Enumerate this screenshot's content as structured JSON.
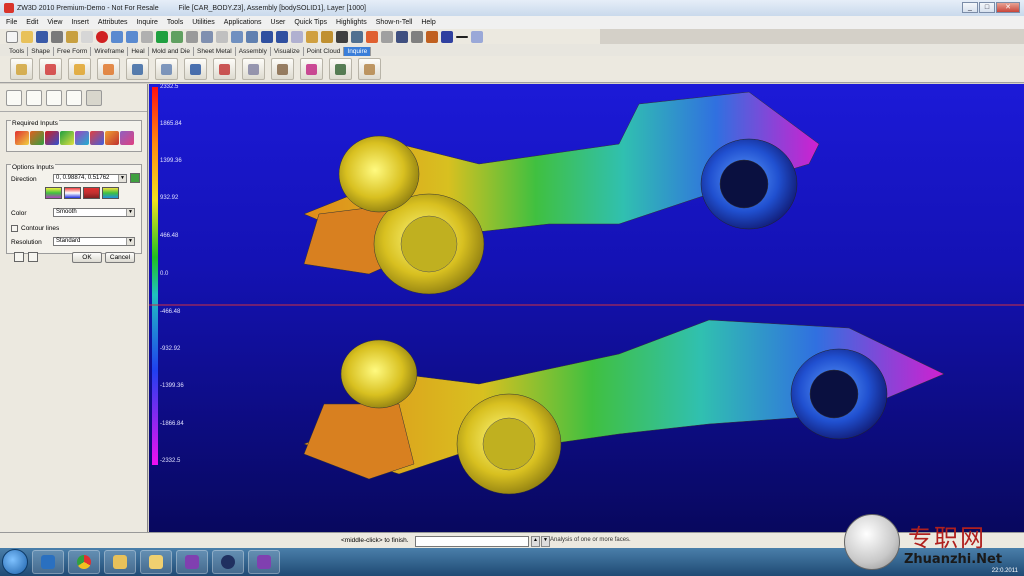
{
  "window": {
    "title_app": "ZW3D 2010 Premium-Demo - Not For Resale",
    "title_file": "File [CAR_BODY.Z3], Assembly [bodySOLID1], Layer [1000]",
    "controls": [
      "_",
      "□",
      "✕"
    ]
  },
  "menu": [
    "File",
    "Edit",
    "View",
    "Insert",
    "Attributes",
    "Inquire",
    "Tools",
    "Utilities",
    "Applications",
    "User",
    "Quick Tips",
    "Highlights",
    "Show-n-Tell",
    "Help"
  ],
  "ribbon_tabs": [
    {
      "label": "Tools",
      "active": false
    },
    {
      "label": "Shape",
      "active": false
    },
    {
      "label": "Free Form",
      "active": false
    },
    {
      "label": "Wireframe",
      "active": false
    },
    {
      "label": "Heal",
      "active": false
    },
    {
      "label": "Mold and Die",
      "active": false
    },
    {
      "label": "Sheet Metal",
      "active": false
    },
    {
      "label": "Assembly",
      "active": false
    },
    {
      "label": "Visualize",
      "active": false
    },
    {
      "label": "Point Cloud",
      "active": false
    },
    {
      "label": "Inquire",
      "active": true
    }
  ],
  "ribbon_icons": [
    "point-info-icon",
    "distance-icon",
    "angle-icon",
    "arc-radius-icon",
    "object-info-icon",
    "pick-info-icon",
    "curvature-icon",
    "draft-angle-icon",
    "zebra-icon",
    "mass-props-icon",
    "curve-list-icon",
    "report-icon",
    "layer-info-icon"
  ],
  "panel": {
    "tabs": [
      "manager-icon",
      "history-icon",
      "assembly-icon",
      "view-icon",
      "inquire-icon"
    ],
    "required_title": "Required Inputs",
    "options_title": "Options Inputs",
    "direction_label": "Direction",
    "direction_value": "0, 0.98874, 0.51762",
    "color_label": "Color",
    "color_value": "Smooth",
    "contour_lines_label": "Contour lines",
    "resolution_label": "Resolution",
    "resolution_value": "Standard",
    "ok_label": "OK",
    "cancel_label": "Cancel",
    "swatch_colors": [
      "#b040c0",
      "#2030e0",
      "#e03030",
      "#40c040"
    ]
  },
  "legend": {
    "values": [
      "2332.5",
      "1865.84",
      "1399.36",
      "932.92",
      "466.48",
      "0.0",
      "-466.48",
      "-932.92",
      "-1399.36",
      "-1866.84",
      "-2332.5"
    ]
  },
  "command": {
    "prompt": "<middle-click> to finish.",
    "status": "Analysis of one or more faces."
  },
  "taskbar": {
    "items": [
      "explorer-icon",
      "chrome-icon",
      "folder-icon",
      "files-icon",
      "zw3d-icon",
      "media-icon",
      "zw3d2-icon"
    ],
    "time": "22:0.2011"
  },
  "watermark": {
    "cn": "专职网",
    "en": "Zhuanzhi.Net"
  }
}
